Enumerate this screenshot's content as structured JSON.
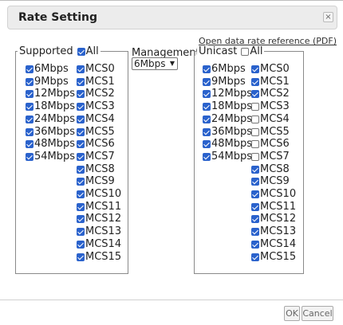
{
  "dialog": {
    "title": "Rate Setting",
    "close_glyph": "×",
    "reference_link": "Open data rate reference (PDF)"
  },
  "supported": {
    "legend": "Supported",
    "all_label": "All",
    "all_checked": true,
    "legacy_rates": [
      {
        "label": "6Mbps",
        "checked": true
      },
      {
        "label": "9Mbps",
        "checked": true
      },
      {
        "label": "12Mbps",
        "checked": true
      },
      {
        "label": "18Mbps",
        "checked": true
      },
      {
        "label": "24Mbps",
        "checked": true
      },
      {
        "label": "36Mbps",
        "checked": true
      },
      {
        "label": "48Mbps",
        "checked": true
      },
      {
        "label": "54Mbps",
        "checked": true
      }
    ],
    "mcs_rates": [
      {
        "label": "MCS0",
        "checked": true
      },
      {
        "label": "MCS1",
        "checked": true
      },
      {
        "label": "MCS2",
        "checked": true
      },
      {
        "label": "MCS3",
        "checked": true
      },
      {
        "label": "MCS4",
        "checked": true
      },
      {
        "label": "MCS5",
        "checked": true
      },
      {
        "label": "MCS6",
        "checked": true
      },
      {
        "label": "MCS7",
        "checked": true
      },
      {
        "label": "MCS8",
        "checked": true
      },
      {
        "label": "MCS9",
        "checked": true
      },
      {
        "label": "MCS10",
        "checked": true
      },
      {
        "label": "MCS11",
        "checked": true
      },
      {
        "label": "MCS12",
        "checked": true
      },
      {
        "label": "MCS13",
        "checked": true
      },
      {
        "label": "MCS14",
        "checked": true
      },
      {
        "label": "MCS15",
        "checked": true
      }
    ]
  },
  "management": {
    "label": "Management",
    "selected": "6Mbps",
    "arrow_glyph": "▼"
  },
  "unicast": {
    "legend": "Unicast",
    "all_label": "All",
    "all_checked": false,
    "legacy_rates": [
      {
        "label": "6Mbps",
        "checked": true
      },
      {
        "label": "9Mbps",
        "checked": true
      },
      {
        "label": "12Mbps",
        "checked": true
      },
      {
        "label": "18Mbps",
        "checked": true
      },
      {
        "label": "24Mbps",
        "checked": true
      },
      {
        "label": "36Mbps",
        "checked": true
      },
      {
        "label": "48Mbps",
        "checked": true
      },
      {
        "label": "54Mbps",
        "checked": true
      }
    ],
    "mcs_rates": [
      {
        "label": "MCS0",
        "checked": true
      },
      {
        "label": "MCS1",
        "checked": true
      },
      {
        "label": "MCS2",
        "checked": true
      },
      {
        "label": "MCS3",
        "checked": false
      },
      {
        "label": "MCS4",
        "checked": false
      },
      {
        "label": "MCS5",
        "checked": false
      },
      {
        "label": "MCS6",
        "checked": false
      },
      {
        "label": "MCS7",
        "checked": false
      },
      {
        "label": "MCS8",
        "checked": true
      },
      {
        "label": "MCS9",
        "checked": true
      },
      {
        "label": "MCS10",
        "checked": true
      },
      {
        "label": "MCS11",
        "checked": true
      },
      {
        "label": "MCS12",
        "checked": true
      },
      {
        "label": "MCS13",
        "checked": true
      },
      {
        "label": "MCS14",
        "checked": true
      },
      {
        "label": "MCS15",
        "checked": true
      }
    ]
  },
  "footer": {
    "ok_label": "OK",
    "cancel_label": "Cancel"
  },
  "colors": {
    "checkbox_checked": "#2a62cc"
  }
}
